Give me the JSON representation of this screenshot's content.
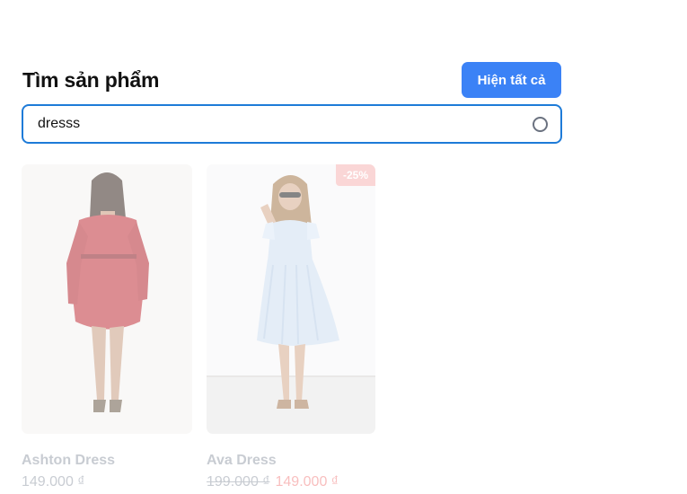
{
  "header": {
    "title": "Tìm sản phẩm",
    "show_all_label": "Hiện tất cả"
  },
  "search": {
    "value": "dresss",
    "loading_icon": "spinner-icon"
  },
  "products": [
    {
      "name": "Ashton Dress",
      "price": "149.000 ₫",
      "image_desc": "woman in red long-sleeve dress, back view"
    },
    {
      "name": "Ava Dress",
      "old_price": "199.000 ₫",
      "sale_price": "149.000 ₫",
      "discount": "-25%",
      "image_desc": "woman in light blue sundress with sunglasses"
    }
  ],
  "colors": {
    "accent": "#3b82f6",
    "focus_border": "#1e7bd8",
    "sale": "#f48a8a"
  }
}
